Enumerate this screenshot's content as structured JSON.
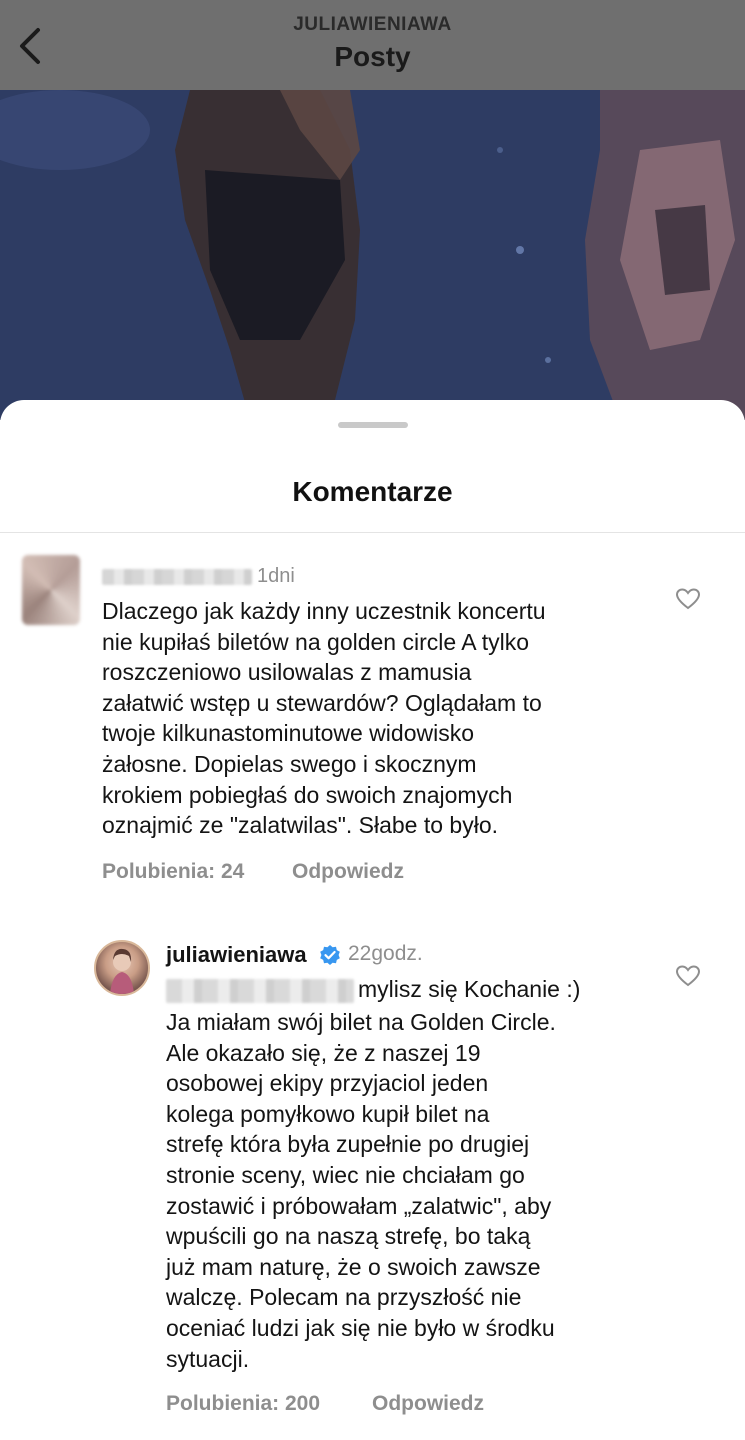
{
  "header": {
    "username": "JULIAWIENIAWA",
    "title": "Posty",
    "back_icon": "chevron-left-icon"
  },
  "sheet": {
    "title": "Komentarze"
  },
  "comments": [
    {
      "username": "",
      "time": "1dni",
      "text": "Dlaczego jak każdy inny uczestnik koncertu\nnie kupiłaś biletów na golden circle A tylko\nroszczeniowo usilowalas z mamusia\nzałatwić wstęp u stewardów? Oglądałam to\ntwoje kilkunastominutowe widowisko\nżałosne.  Dopielas swego i skocznym\nkrokiem pobiegłaś do swoich znajomych\noznajmić ze \"zalatwilas\". Słabe to było.",
      "likes": "Polubienia: 24",
      "reply": "Odpowiedz",
      "like_icon": "heart-icon"
    },
    {
      "username": "juliawieniawa",
      "verified_icon": "verified-badge-icon",
      "time": "22godz.",
      "first_line": "mylisz się Kochanie :)",
      "text": "Ja miałam swój bilet na Golden Circle.\nAle okazało się, że z naszej 19\nosobowej ekipy przyjaciol jeden\nkolega pomyłkowo kupił bilet na\nstrefę która była zupełnie po drugiej\nstronie sceny, wiec nie chciałam go\nzostawić i próbowałam „zalatwic\", aby\nwpuścili go na naszą strefę, bo taką\njuż mam naturę, że o swoich zawsze\nwalczę. Polecam na przyszłość nie\noceniać ludzi jak się nie było w środku\nsytuacji.",
      "likes": "Polubienia: 200",
      "reply": "Odpowiedz",
      "like_icon": "heart-icon"
    }
  ]
}
